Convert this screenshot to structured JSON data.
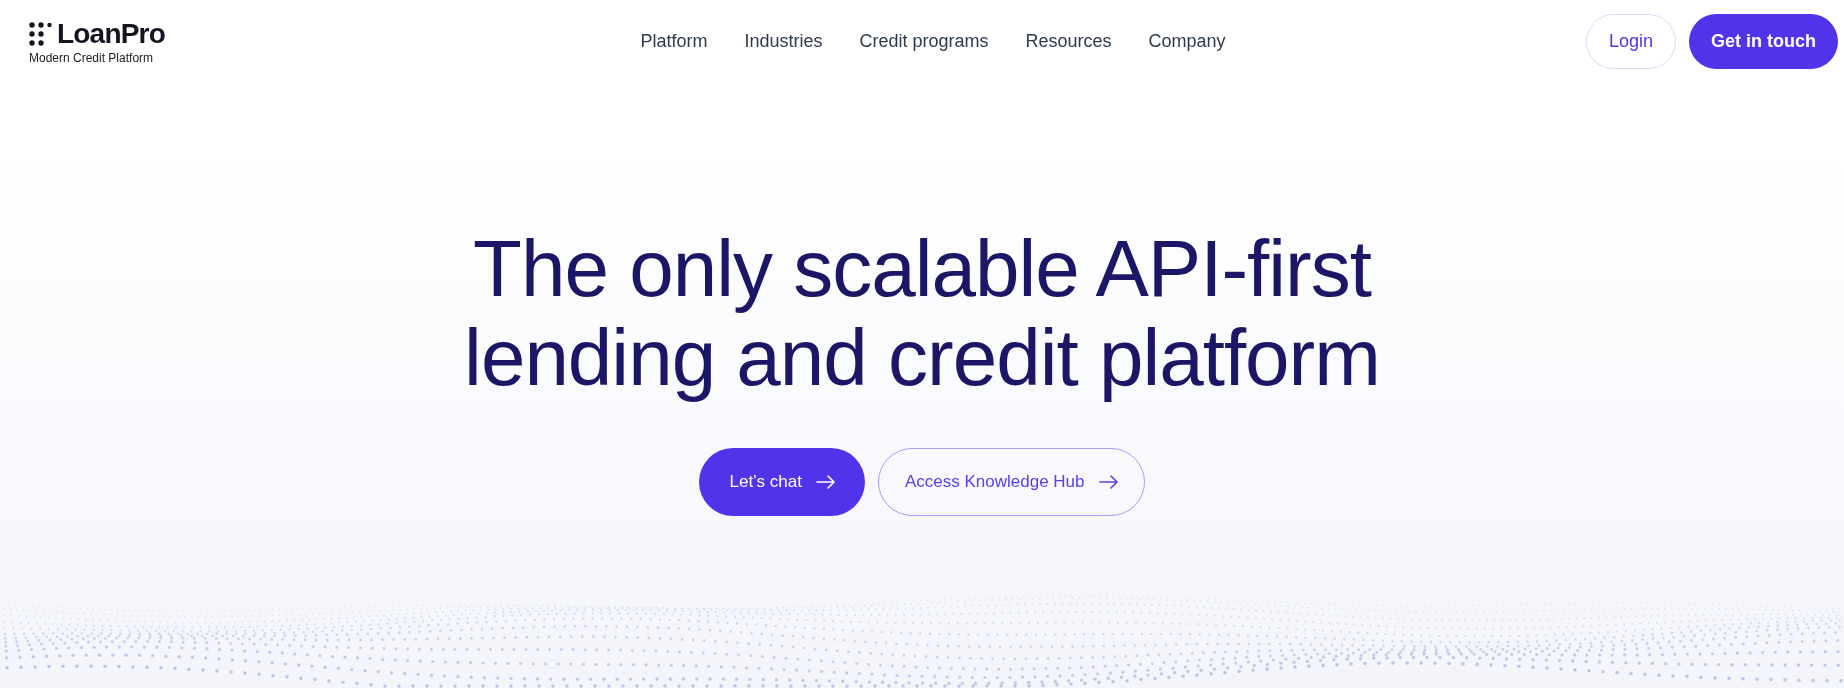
{
  "header": {
    "logo": {
      "name": "LoanPro",
      "tagline": "Modern Credit Platform"
    },
    "nav": [
      {
        "label": "Platform"
      },
      {
        "label": "Industries"
      },
      {
        "label": "Credit programs"
      },
      {
        "label": "Resources"
      },
      {
        "label": "Company"
      }
    ],
    "actions": [
      {
        "label": "Login",
        "kind": "outline"
      },
      {
        "label": "Get in touch",
        "kind": "primary"
      }
    ]
  },
  "hero": {
    "title_lines": [
      "The only scalable API-first",
      "lending and credit platform"
    ],
    "buttons": [
      {
        "label": "Let’s chat",
        "kind": "primary"
      },
      {
        "label": "Access Knowledge Hub",
        "kind": "outline"
      }
    ]
  }
}
